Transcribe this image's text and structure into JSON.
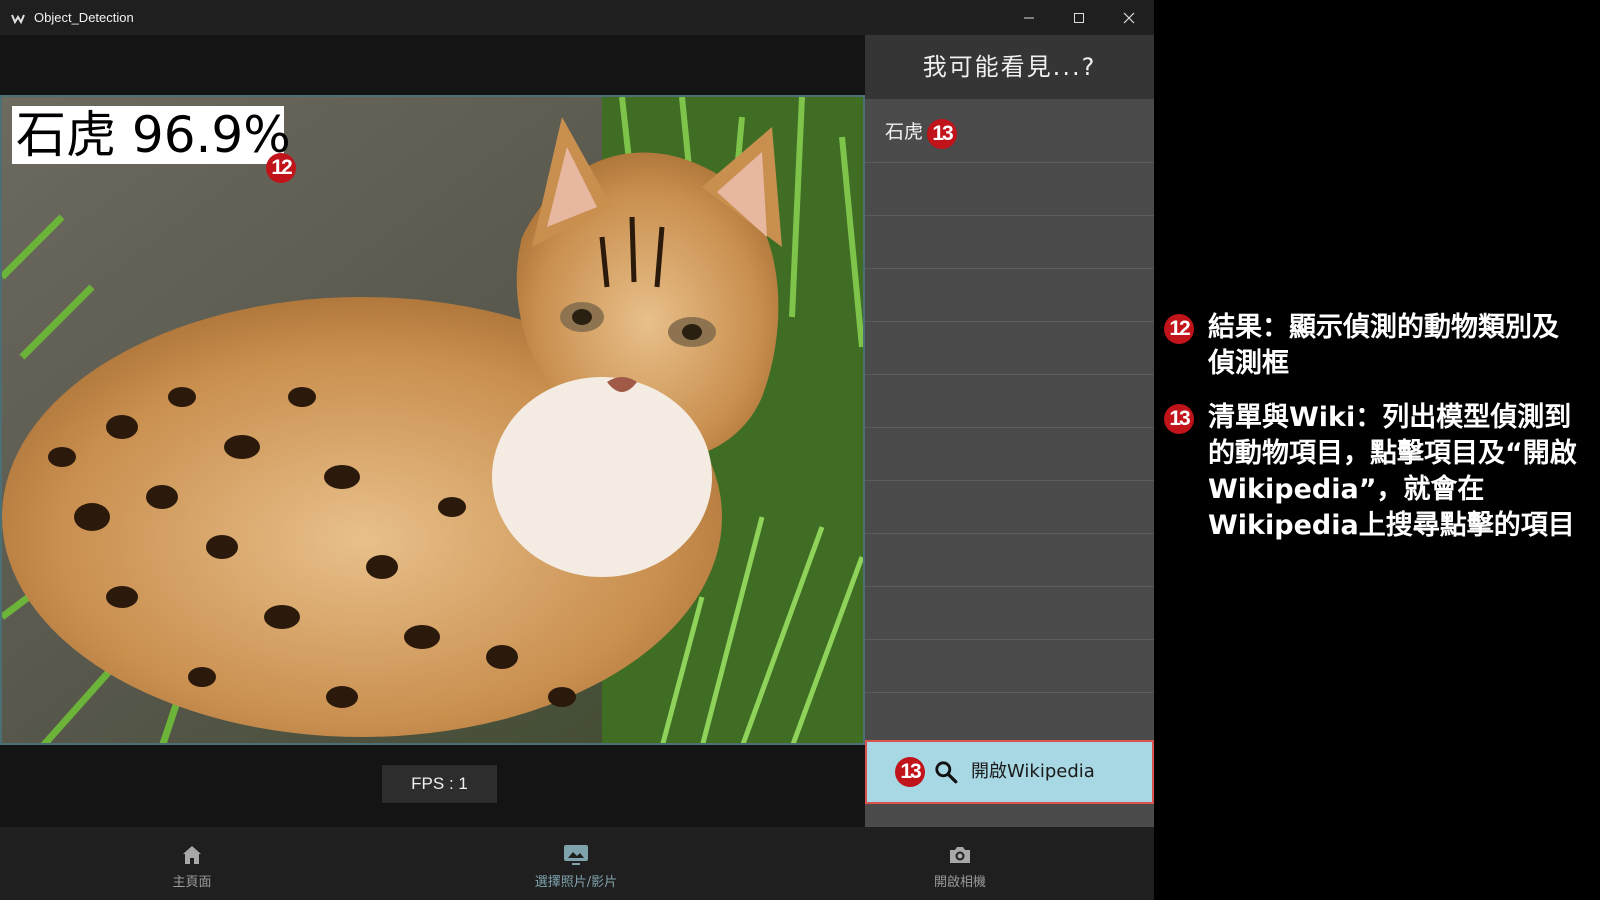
{
  "window": {
    "title": "Object_Detection"
  },
  "detection": {
    "label": "石虎 96.9%",
    "badge": "12"
  },
  "fps": "FPS : 1",
  "right_panel": {
    "header": "我可能看見...?",
    "items": [
      {
        "label": "石虎",
        "badge": "13"
      }
    ],
    "wiki_button": {
      "label": "開啟Wikipedia",
      "badge": "13"
    }
  },
  "nav": [
    {
      "label": "主頁面",
      "icon": "home-icon"
    },
    {
      "label": "選擇照片/影片",
      "icon": "image-gallery-icon"
    },
    {
      "label": "開啟相機",
      "icon": "camera-icon"
    }
  ],
  "nav_active_index": 1,
  "annotations": [
    {
      "badge": "12",
      "text": "結果：顯示偵測的動物類別及偵測框"
    },
    {
      "badge": "13",
      "text": "清單與Wiki：列出模型偵測到的動物項目，點擊項目及“開啟Wikipedia”，就會在Wikipedia上搜尋點擊的項目"
    }
  ],
  "colors": {
    "badge": "#c0131a",
    "wiki_button_bg": "#a8d8e4",
    "wiki_button_border": "#d9534f",
    "active_nav": "#7fa3ad"
  }
}
